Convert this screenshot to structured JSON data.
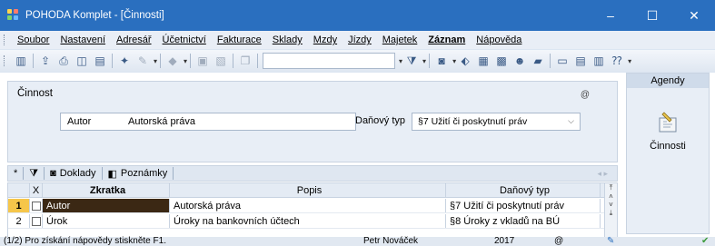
{
  "window": {
    "title": "POHODA Komplet - [Činnosti]",
    "minimize": "–",
    "maximize": "☐",
    "close": "✕"
  },
  "menu": [
    {
      "label": "Soubor",
      "bold": false
    },
    {
      "label": "Nastavení",
      "bold": false
    },
    {
      "label": "Adresář",
      "bold": false
    },
    {
      "label": "Účetnictví",
      "bold": false
    },
    {
      "label": "Fakturace",
      "bold": false
    },
    {
      "label": "Sklady",
      "bold": false
    },
    {
      "label": "Mzdy",
      "bold": false
    },
    {
      "label": "Jízdy",
      "bold": false
    },
    {
      "label": "Majetek",
      "bold": false
    },
    {
      "label": "Záznam",
      "bold": true
    },
    {
      "label": "Nápověda",
      "bold": false
    }
  ],
  "form": {
    "title": "Činnost",
    "at_symbol": "@",
    "code_value": "Autor",
    "name_value": "Autorská práva",
    "tax_label": "Daňový typ",
    "tax_value": "§7  Užití či poskytnutí práv"
  },
  "agenda": {
    "header": "Agendy",
    "item_label": "Činnosti"
  },
  "tabs": {
    "star": "*",
    "docs": "Doklady",
    "notes": "Poznámky"
  },
  "grid": {
    "headers": {
      "x": "X",
      "code": "Zkratka",
      "desc": "Popis",
      "tax": "Daňový typ"
    },
    "rows": [
      {
        "num": "1",
        "code": "Autor",
        "desc": "Autorská práva",
        "tax": "§7  Užití či poskytnutí práv"
      },
      {
        "num": "2",
        "code": "Úrok",
        "desc": "Úroky na bankovních účtech",
        "tax": "§8  Úroky z vkladů na BÚ"
      }
    ]
  },
  "status": {
    "help": "(1/2) Pro získání nápovědy stiskněte F1.",
    "user": "Petr Nováček",
    "year": "2017",
    "at": "@"
  },
  "colors": {
    "titlebar": "#2a6fbf",
    "selected_row_marker": "#f6c64a",
    "selected_cell": "#3b2814"
  }
}
